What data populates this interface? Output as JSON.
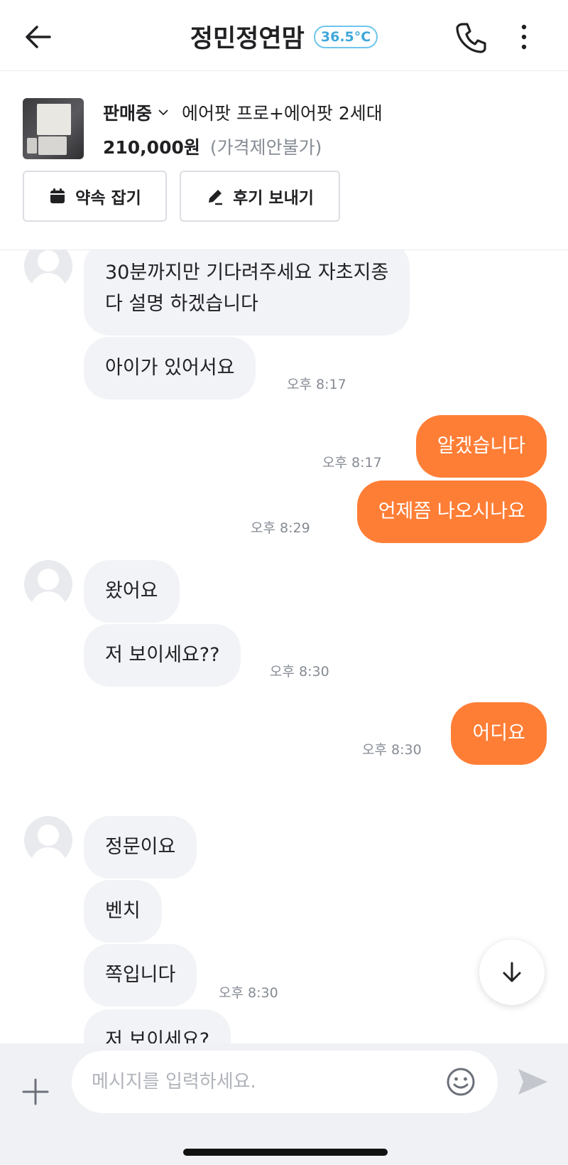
{
  "header": {
    "title": "정민정연맘",
    "temperature": "36.5°C",
    "icons": {
      "back": "arrow-left-icon",
      "call": "phone-icon",
      "more": "more-vertical-icon"
    },
    "colors": {
      "temperature": "#3fa7d9"
    }
  },
  "product": {
    "status": "판매중",
    "title": "에어팟 프로+에어팟 2세대",
    "price": "210,000원",
    "price_note": "(가격제안불가)",
    "buttons": {
      "appointment": "약속 잡기",
      "review": "후기 보내기"
    }
  },
  "messages": [
    {
      "side": "in",
      "text": "30분까지만 기다려주세요 자초지종\n다 설명 하겠습니다"
    },
    {
      "side": "in",
      "text": "아이가 있어서요",
      "time": "오후 8:17"
    },
    {
      "side": "out",
      "text": "알겠습니다",
      "time": "오후 8:17"
    },
    {
      "side": "out",
      "text": "언제쯤 나오시나요",
      "time": "오후 8:29"
    },
    {
      "side": "in",
      "text": "왔어요"
    },
    {
      "side": "in",
      "text": "저 보이세요??",
      "time": "오후 8:30"
    },
    {
      "side": "out",
      "text": "어디요",
      "time": "오후 8:30"
    },
    {
      "side": "in",
      "text": "정문이요"
    },
    {
      "side": "in",
      "text": "벤치"
    },
    {
      "side": "in",
      "text": "쪽입니다",
      "time": "오후 8:30"
    },
    {
      "side": "in",
      "text": "저 보이세요?"
    }
  ],
  "composer": {
    "placeholder": "메시지를 입력하세요."
  },
  "colors": {
    "outgoing_bubble": "#ff7e36",
    "incoming_bubble": "#f2f3f6"
  }
}
